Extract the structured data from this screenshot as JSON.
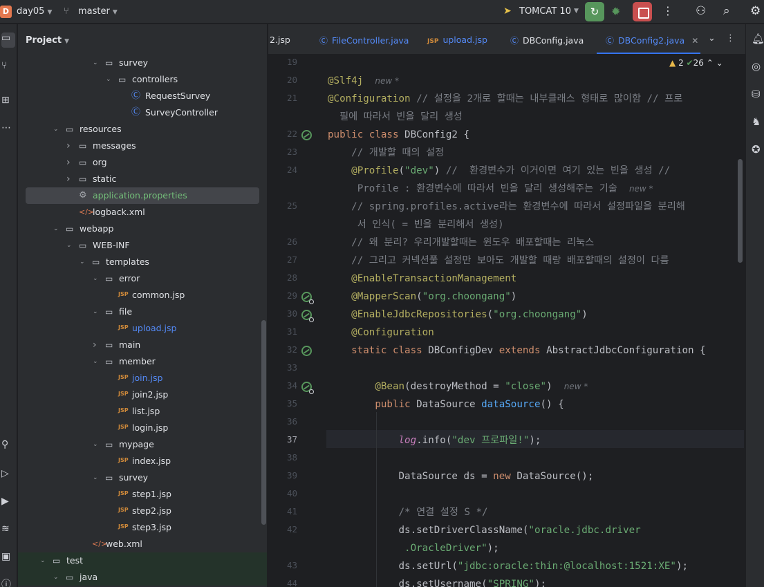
{
  "topbar": {
    "project_badge": "D",
    "project_name": "day05",
    "branch": "master",
    "run_config": "TOMCAT 10"
  },
  "project_panel": {
    "title": "Project",
    "tree": [
      {
        "label": "survey",
        "depth": 7,
        "kind": "folder",
        "arrow": "open"
      },
      {
        "label": "controllers",
        "depth": 8,
        "kind": "folder",
        "arrow": "open"
      },
      {
        "label": "RequestSurvey",
        "depth": 9,
        "kind": "class"
      },
      {
        "label": "SurveyController",
        "depth": 9,
        "kind": "class"
      },
      {
        "label": "resources",
        "depth": 4,
        "kind": "folder",
        "arrow": "open"
      },
      {
        "label": "messages",
        "depth": 5,
        "kind": "folder",
        "arrow": "closed"
      },
      {
        "label": "org",
        "depth": 5,
        "kind": "folder",
        "arrow": "closed"
      },
      {
        "label": "static",
        "depth": 5,
        "kind": "folder",
        "arrow": "closed"
      },
      {
        "label": "application.properties",
        "depth": 5,
        "kind": "gear",
        "selected": true,
        "color": "green"
      },
      {
        "label": "logback.xml",
        "depth": 5,
        "kind": "xml"
      },
      {
        "label": "webapp",
        "depth": 4,
        "kind": "folder",
        "arrow": "open"
      },
      {
        "label": "WEB-INF",
        "depth": 5,
        "kind": "folder",
        "arrow": "open"
      },
      {
        "label": "templates",
        "depth": 6,
        "kind": "folder",
        "arrow": "open"
      },
      {
        "label": "error",
        "depth": 7,
        "kind": "folder",
        "arrow": "open"
      },
      {
        "label": "common.jsp",
        "depth": 8,
        "kind": "jsp"
      },
      {
        "label": "file",
        "depth": 7,
        "kind": "folder",
        "arrow": "open"
      },
      {
        "label": "upload.jsp",
        "depth": 8,
        "kind": "jsp",
        "color": "blue"
      },
      {
        "label": "main",
        "depth": 7,
        "kind": "folder",
        "arrow": "closed"
      },
      {
        "label": "member",
        "depth": 7,
        "kind": "folder",
        "arrow": "open"
      },
      {
        "label": "join.jsp",
        "depth": 8,
        "kind": "jsp",
        "color": "blue"
      },
      {
        "label": "join2.jsp",
        "depth": 8,
        "kind": "jsp"
      },
      {
        "label": "list.jsp",
        "depth": 8,
        "kind": "jsp"
      },
      {
        "label": "login.jsp",
        "depth": 8,
        "kind": "jsp"
      },
      {
        "label": "mypage",
        "depth": 7,
        "kind": "folder",
        "arrow": "open"
      },
      {
        "label": "index.jsp",
        "depth": 8,
        "kind": "jsp"
      },
      {
        "label": "survey",
        "depth": 7,
        "kind": "folder",
        "arrow": "open"
      },
      {
        "label": "step1.jsp",
        "depth": 8,
        "kind": "jsp"
      },
      {
        "label": "step2.jsp",
        "depth": 8,
        "kind": "jsp"
      },
      {
        "label": "step3.jsp",
        "depth": 8,
        "kind": "jsp"
      },
      {
        "label": "web.xml",
        "depth": 6,
        "kind": "xml"
      },
      {
        "label": "test",
        "depth": 3,
        "kind": "folder",
        "arrow": "open",
        "test": true
      },
      {
        "label": "java",
        "depth": 4,
        "kind": "folder",
        "arrow": "open",
        "test": true
      }
    ]
  },
  "tabs": [
    {
      "label": "2.jsp",
      "icon": "jsp"
    },
    {
      "label": "FileController.java",
      "icon": "class",
      "blue": true
    },
    {
      "label": "upload.jsp",
      "icon": "jsp",
      "blue": true
    },
    {
      "label": "DBConfig.java",
      "icon": "class"
    },
    {
      "label": "DBConfig2.java",
      "icon": "class",
      "active": true
    }
  ],
  "editor": {
    "inspections": {
      "warnings": "2",
      "ok": "26"
    },
    "line_numbers": [
      "19",
      "20",
      "21",
      "",
      "22",
      "23",
      "24",
      "",
      "25",
      "",
      "26",
      "27",
      "28",
      "29",
      "30",
      "31",
      "32",
      "33",
      "34",
      "35",
      "36",
      "37",
      "38",
      "39",
      "40",
      "41",
      "42",
      "",
      "43",
      "44"
    ],
    "hint_new": "new *",
    "lines": [
      [],
      [
        [
          "ann",
          "@Slf4j"
        ],
        [
          "sp",
          "  "
        ],
        [
          "hint",
          "new *"
        ]
      ],
      [
        [
          "ann",
          "@Configuration"
        ],
        [
          "cm",
          " // 설정을 2개로 할때는 내부클래스 형태로 많이함 // 프로"
        ]
      ],
      [
        [
          "cm",
          "  필에 따라서 빈을 달리 생성"
        ]
      ],
      [
        [
          "kw",
          "public class "
        ],
        [
          "tx",
          "DBConfig2 {"
        ]
      ],
      [
        [
          "cm",
          "    // 개발할 때의 설정"
        ]
      ],
      [
        [
          "ann",
          "    @Profile"
        ],
        [
          "tx",
          "("
        ],
        [
          "str",
          "\"dev\""
        ],
        [
          "tx",
          ")"
        ],
        [
          "cm",
          " //  환경변수가 이거이면 여기 있는 빈을 생성 //"
        ]
      ],
      [
        [
          "cm",
          "     Profile : 환경변수에 따라서 빈을 달리 생성해주는 기술"
        ],
        [
          "sp",
          "  "
        ],
        [
          "hint",
          "new *"
        ]
      ],
      [
        [
          "cm",
          "    // spring.profiles.active라는 환경변수에 따라서 설정파일을 분리해"
        ]
      ],
      [
        [
          "cm",
          "     서 인식( = 빈을 분리해서 생성)"
        ]
      ],
      [
        [
          "cm",
          "    // 왜 분리? 우리개발할때는 윈도우 배포할때는 리눅스"
        ]
      ],
      [
        [
          "cm",
          "    // 그리고 커넥션풀 설정만 보아도 개발할 때랑 배포할때의 설정이 다름"
        ]
      ],
      [
        [
          "ann",
          "    @EnableTransactionManagement"
        ]
      ],
      [
        [
          "ann",
          "    @MapperScan"
        ],
        [
          "tx",
          "("
        ],
        [
          "str",
          "\"org.choongang\""
        ],
        [
          "tx",
          ")"
        ]
      ],
      [
        [
          "ann",
          "    @EnableJdbcRepositories"
        ],
        [
          "tx",
          "("
        ],
        [
          "str",
          "\"org.choongang\""
        ],
        [
          "tx",
          ")"
        ]
      ],
      [
        [
          "ann",
          "    @Configuration"
        ]
      ],
      [
        [
          "kw",
          "    static class "
        ],
        [
          "tx",
          "DBConfigDev "
        ],
        [
          "kw",
          "extends "
        ],
        [
          "tx",
          "AbstractJdbcConfiguration {"
        ]
      ],
      [],
      [
        [
          "ann",
          "        @Bean"
        ],
        [
          "tx",
          "(destroyMethod = "
        ],
        [
          "str",
          "\"close\""
        ],
        [
          "tx",
          ")"
        ],
        [
          "sp",
          "  "
        ],
        [
          "hint",
          "new *"
        ]
      ],
      [
        [
          "kw",
          "        public "
        ],
        [
          "tx",
          "DataSource "
        ],
        [
          "fn",
          "dataSource"
        ],
        [
          "tx",
          "() {"
        ]
      ],
      [],
      [
        [
          "fld",
          "            log"
        ],
        [
          "tx",
          ".info("
        ],
        [
          "str",
          "\"dev 프로파일!\""
        ],
        [
          "tx",
          ");"
        ]
      ],
      [],
      [
        [
          "tx",
          "            DataSource ds = "
        ],
        [
          "kw",
          "new "
        ],
        [
          "tx",
          "DataSource();"
        ]
      ],
      [],
      [
        [
          "cm",
          "            /* 연결 설정 S */"
        ]
      ],
      [
        [
          "tx",
          "            ds.setDriverClassName("
        ],
        [
          "str",
          "\"oracle.jdbc.driver"
        ]
      ],
      [
        [
          "str",
          "             .OracleDriver\""
        ],
        [
          "tx",
          ");"
        ]
      ],
      [
        [
          "tx",
          "            ds.setUrl("
        ],
        [
          "str",
          "\"jdbc:oracle:thin:@localhost:1521:XE\""
        ],
        [
          "tx",
          ");"
        ]
      ],
      [
        [
          "tx",
          "            ds.setUsername("
        ],
        [
          "str",
          "\"SPRING\""
        ],
        [
          "tx",
          ");"
        ]
      ]
    ]
  }
}
